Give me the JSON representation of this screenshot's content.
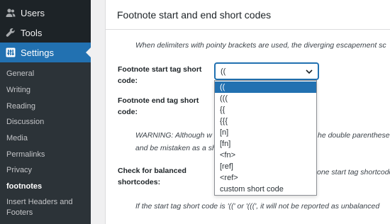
{
  "sidebar": {
    "menu": [
      {
        "label": "Users",
        "icon": "users-icon"
      },
      {
        "label": "Tools",
        "icon": "wrench-icon"
      },
      {
        "label": "Settings",
        "icon": "settings-icon"
      }
    ],
    "submenu": [
      {
        "label": "General"
      },
      {
        "label": "Writing"
      },
      {
        "label": "Reading"
      },
      {
        "label": "Discussion"
      },
      {
        "label": "Media"
      },
      {
        "label": "Permalinks"
      },
      {
        "label": "Privacy"
      },
      {
        "label": "footnotes"
      },
      {
        "label": "Insert Headers and"
      },
      {
        "label": "Footers"
      }
    ]
  },
  "main": {
    "section_title": "Footnote start and end short codes",
    "desc_delimiters": "When delimiters with pointy brackets are used, the diverging escapement sc",
    "start_label_1": "Footnote start tag short",
    "start_label_2": "code:",
    "start_select_value": "((",
    "end_label_1": "Footnote end tag short",
    "end_label_2": "code:",
    "warning_1": "WARNING: Although w",
    "warning_1b": "he double parenthese",
    "warning_2": "and be mistaken as a sh",
    "balanced_label_1": "Check for balanced",
    "balanced_label_2": "shortcodes:",
    "balanced_hint": "one start tag shortcode,",
    "bottom_desc": "If the start tag short code is '((' or '(((', it will not be reported as unbalanced"
  },
  "dropdown": {
    "options": [
      "((",
      "(((",
      "{{",
      "{{{",
      "[n]",
      "[fn]",
      "<fn>",
      "[ref]",
      "<ref>",
      "custom short code"
    ],
    "selected_index": 0
  },
  "colors": {
    "sidebar_bg": "#1d2327",
    "submenu_bg": "#2c3338",
    "accent": "#2271b1"
  }
}
